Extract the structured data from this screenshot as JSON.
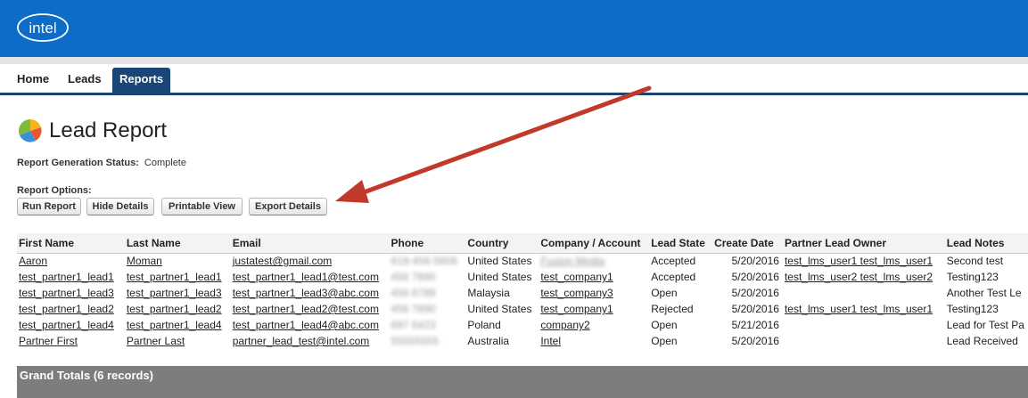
{
  "brand": {
    "logo_text": "intel",
    "header_color": "#0c6cc8",
    "tab_active_color": "#1a4576"
  },
  "tabs": [
    {
      "label": "Home",
      "active": false
    },
    {
      "label": "Leads",
      "active": false
    },
    {
      "label": "Reports",
      "active": true
    }
  ],
  "page": {
    "title": "Lead Report",
    "status_label": "Report Generation Status:",
    "status_value": "Complete",
    "options_label": "Report Options:"
  },
  "buttons": {
    "run": "Run Report",
    "hide": "Hide Details",
    "printable": "Printable View",
    "export": "Export Details"
  },
  "table": {
    "headers": [
      "First Name",
      "Last Name",
      "Email",
      "Phone",
      "Country",
      "Company / Account",
      "Lead State",
      "Create Date",
      "Partner Lead Owner",
      "Lead Notes"
    ],
    "rows": [
      [
        "Aaron",
        "Moman",
        "justatest@gmail.com",
        "818-456-5606",
        "United States",
        "Fusion Media",
        "Accepted",
        "5/20/2016",
        "test_lms_user1 test_lms_user1",
        "Second test"
      ],
      [
        "test_partner1_lead1",
        "test_partner1_lead1",
        "test_partner1_lead1@test.com",
        "456 7890",
        "United States",
        "test_company1",
        "Accepted",
        "5/20/2016",
        "test_lms_user2 test_lms_user2",
        "Testing123"
      ],
      [
        "test_partner1_lead3",
        "test_partner1_lead3",
        "test_partner1_lead3@abc.com",
        "456 6789",
        "Malaysia",
        "test_company3",
        "Open",
        "5/20/2016",
        "",
        "Another Test Le"
      ],
      [
        "test_partner1_lead2",
        "test_partner1_lead2",
        "test_partner1_lead2@test.com",
        "456 7890",
        "United States",
        "test_company1",
        "Rejected",
        "5/20/2016",
        "test_lms_user1 test_lms_user1",
        "Testing123"
      ],
      [
        "test_partner1_lead4",
        "test_partner1_lead4",
        "test_partner1_lead4@abc.com",
        "897 6423",
        "Poland",
        "company2",
        "Open",
        "5/21/2016",
        "",
        "Lead for Test Pa"
      ],
      [
        "Partner First",
        "Partner Last",
        "partner_lead_test@intel.com",
        "55555555",
        "Australia",
        "Intel",
        "Open",
        "5/20/2016",
        "",
        "Lead Received"
      ]
    ]
  },
  "grand_totals": "Grand Totals (6 records)",
  "annotation": {
    "arrow_color": "#c0392b"
  }
}
